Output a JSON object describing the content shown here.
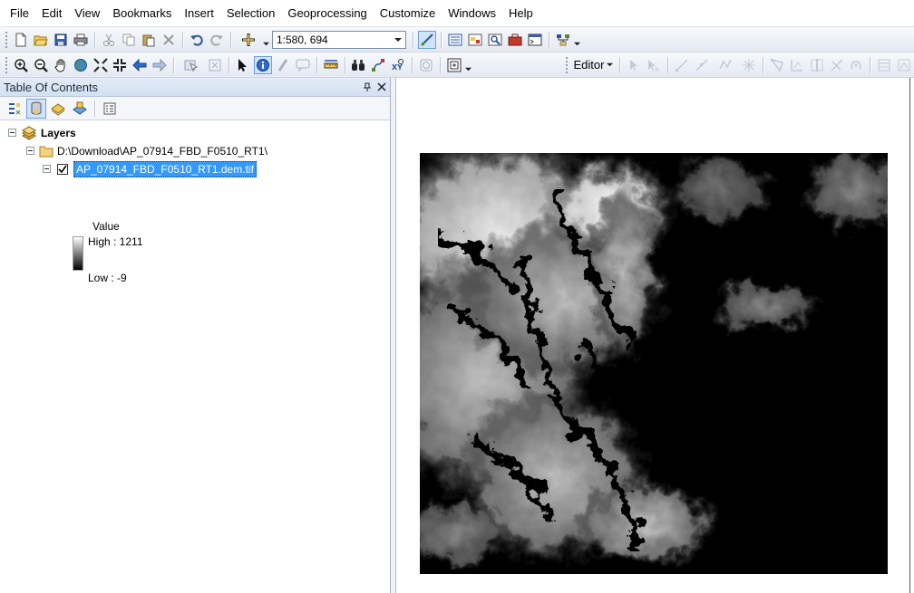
{
  "menubar": {
    "items": [
      "File",
      "Edit",
      "View",
      "Bookmarks",
      "Insert",
      "Selection",
      "Geoprocessing",
      "Customize",
      "Windows",
      "Help"
    ]
  },
  "toolbar": {
    "scale_value": "1:580, 694",
    "editor_label": "Editor"
  },
  "toc": {
    "title": "Table Of Contents",
    "root_label": "Layers",
    "folder_label": "D:\\Download\\AP_07914_FBD_F0510_RT1\\",
    "layer_label": "AP_07914_FBD_F0510_RT1.dem.tif",
    "layer_checked": true,
    "legend": {
      "heading": "Value",
      "high": "High : 1211",
      "low": "Low : -9"
    }
  },
  "colors": {
    "selection_highlight": "#3399ff",
    "panel_header": "#d3e0f1",
    "map_background": "#ffffff"
  }
}
